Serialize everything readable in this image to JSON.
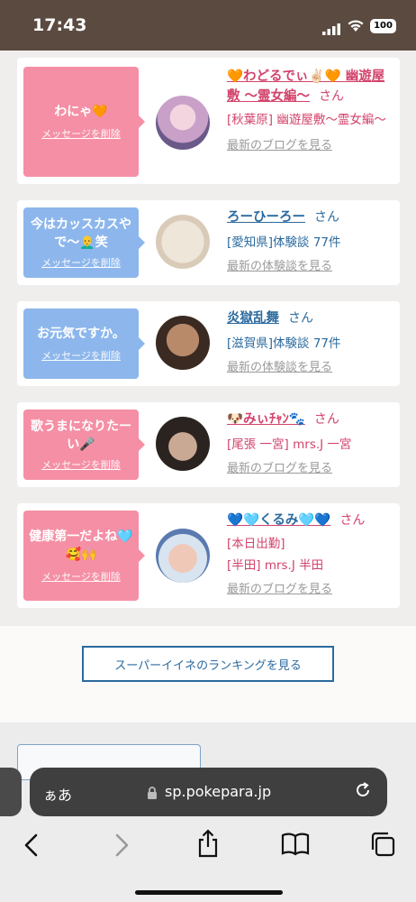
{
  "status": {
    "time": "17:43",
    "battery": "100"
  },
  "cards": [
    {
      "bubble_color": "#f58fa5",
      "message": "わにゃ🧡",
      "delete_label": "メッセージを削除",
      "name": "🧡わどるでぃ✌🏻🧡 幽遊屋敷 〜霊女編〜",
      "name_color": "#d2436b",
      "suffix": "さん",
      "lines": [
        "[秋葉原] 幽遊屋敷〜霊女編〜"
      ],
      "link": "最新のブログを見る"
    },
    {
      "bubble_color": "#8db7ec",
      "message": "今はカッスカスやで〜👨‍🦲笑",
      "delete_label": "メッセージを削除",
      "name": "ろーひーろー",
      "name_color": "#2b6a9e",
      "suffix": "さん",
      "lines": [
        "[愛知県]体験談 77件"
      ],
      "link": "最新の体験談を見る"
    },
    {
      "bubble_color": "#8db7ec",
      "message": "お元気ですか。",
      "delete_label": "メッセージを削除",
      "name": "炎獄乱舞",
      "name_color": "#2b6a9e",
      "suffix": "さん",
      "lines": [
        "[滋賀県]体験談 77件"
      ],
      "link": "最新の体験談を見る"
    },
    {
      "bubble_color": "#f58fa5",
      "message": "歌うまになりたーい🎤",
      "delete_label": "メッセージを削除",
      "name": "🐶みぃﾁｬﾝ🐾",
      "name_color": "#d2436b",
      "suffix": "さん",
      "lines": [
        "[尾張 一宮] mrs.J 一宮"
      ],
      "link": "最新のブログを見る"
    },
    {
      "bubble_color": "#f58fa5",
      "message": "健康第一だよね🩵🥰🙌",
      "delete_label": "メッセージを削除",
      "name": "💙🩵くるみ🩵💙",
      "name_color": "#d2436b",
      "suffix": "さん",
      "lines": [
        "[本日出勤]",
        "[半田] mrs.J 半田"
      ],
      "link": "最新のブログを見る"
    }
  ],
  "ranking_button": "スーパーイイネのランキングを見る",
  "browser": {
    "aa": "ぁあ",
    "url": "sp.pokepara.jp"
  },
  "icons": [
    "signal-icon",
    "wifi-icon",
    "lock-icon",
    "reload-icon",
    "back-icon",
    "forward-icon",
    "share-icon",
    "bookmarks-icon",
    "tabs-icon"
  ]
}
